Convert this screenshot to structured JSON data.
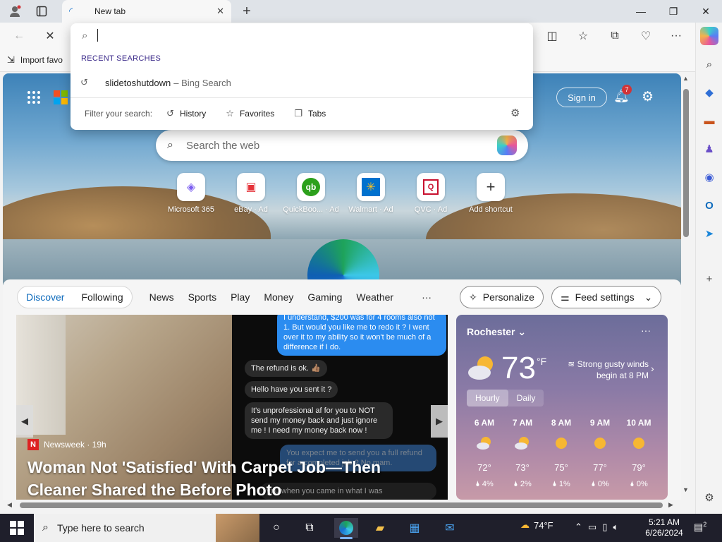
{
  "tab": {
    "title": "New tab"
  },
  "favbar": {
    "import_label": "Import favo"
  },
  "dropdown": {
    "recent_heading": "RECENT SEARCHES",
    "recent_items": [
      {
        "query": "slidetoshutdown",
        "source": "– Bing Search"
      }
    ],
    "filter_label": "Filter your search:",
    "filters": [
      "History",
      "Favorites",
      "Tabs"
    ]
  },
  "newtab": {
    "signin": "Sign in",
    "notification_count": "7",
    "search_placeholder": "Search the web",
    "shortcuts": [
      {
        "label": "Microsoft 365",
        "icon": "microsoft-365-icon",
        "glyph": "◈",
        "color": "#7a5cf0"
      },
      {
        "label": "eBay · Ad",
        "icon": "ebay-bag-icon",
        "glyph": "▣",
        "color": "#e53238"
      },
      {
        "label": "QuickBoo... · Ad",
        "icon": "quickbooks-icon",
        "glyph": "qb",
        "color": "#2ca01c"
      },
      {
        "label": "Walmart · Ad",
        "icon": "walmart-icon",
        "glyph": "✳",
        "color": "#0071ce"
      },
      {
        "label": "QVC · Ad",
        "icon": "qvc-icon",
        "glyph": "Q",
        "color": "#c8102e"
      },
      {
        "label": "Add shortcut",
        "icon": "plus-icon",
        "glyph": "+",
        "color": "#333333"
      }
    ]
  },
  "feed": {
    "tabs": [
      "Discover",
      "Following"
    ],
    "nav": [
      "News",
      "Sports",
      "Play",
      "Money",
      "Gaming",
      "Weather"
    ],
    "more": "···",
    "personalize": "Personalize",
    "feed_settings": "Feed settings",
    "article": {
      "source": "Newsweek · 19h",
      "headline": "Woman Not 'Satisfied' With Carpet Job—Then Cleaner Shared the Before Photo",
      "chat": [
        "I understand, $200 was for 4 rooms also not 1. But would you like me to redo it ? I went over it to my ability so it won't be much of a difference if I do.",
        "The refund is ok. 👍🏽",
        "Hello have you sent it ?",
        "It's unprofessional af for you to NOT send my money back and just ignore me ! I need my money back now !",
        "You expect me to send you a full refund for a completed job ? No mam.",
        "you when you came in what I was"
      ]
    }
  },
  "weather": {
    "city": "Rochester",
    "temp": "73",
    "unit": "°F",
    "alert": "Strong gusty winds begin at 8 PM",
    "toggle": [
      "Hourly",
      "Daily"
    ],
    "hours": [
      {
        "time": "6 AM",
        "temp": "72°",
        "precip": "🌢 4%"
      },
      {
        "time": "7 AM",
        "temp": "73°",
        "precip": "🌢 2%"
      },
      {
        "time": "8 AM",
        "temp": "75°",
        "precip": "🌢 1%"
      },
      {
        "time": "9 AM",
        "temp": "77°",
        "precip": "🌢 0%"
      },
      {
        "time": "10 AM",
        "temp": "79°",
        "precip": "🌢 0%"
      }
    ]
  },
  "taskbar": {
    "search_placeholder": "Type here to search",
    "weather": "74°F",
    "time": "5:21 AM",
    "date": "6/26/2024",
    "notifications": "2"
  }
}
